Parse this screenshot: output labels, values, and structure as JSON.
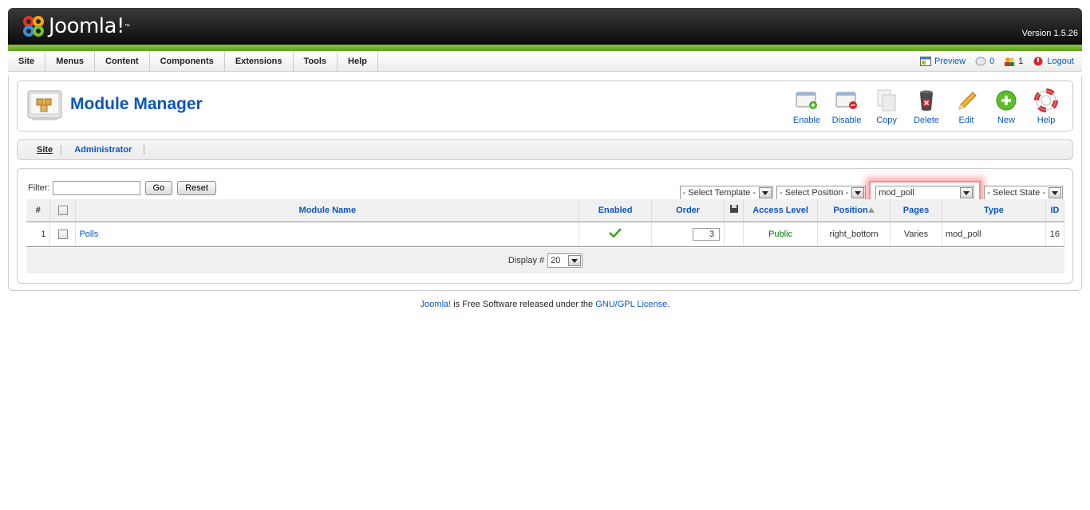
{
  "header": {
    "logo_text": "Joomla!",
    "logo_tm": "™",
    "version": "Version 1.5.26"
  },
  "menu": [
    "Site",
    "Menus",
    "Content",
    "Components",
    "Extensions",
    "Tools",
    "Help"
  ],
  "status": {
    "preview": "Preview",
    "messages_count": "0",
    "users_count": "1",
    "logout": "Logout"
  },
  "page": {
    "title": "Module Manager"
  },
  "toolbar": {
    "enable": "Enable",
    "disable": "Disable",
    "copy": "Copy",
    "delete": "Delete",
    "edit": "Edit",
    "new": "New",
    "help": "Help"
  },
  "submenu": {
    "site": "Site",
    "administrator": "Administrator"
  },
  "filter": {
    "label": "Filter:",
    "value": "",
    "go": "Go",
    "reset": "Reset",
    "select_template": "- Select Template -",
    "select_position": "- Select Position -",
    "select_type": "mod_poll",
    "select_state": "- Select State -"
  },
  "table": {
    "headers": {
      "num": "#",
      "name": "Module Name",
      "enabled": "Enabled",
      "order": "Order",
      "access": "Access Level",
      "position": "Position",
      "pages": "Pages",
      "type": "Type",
      "id": "ID"
    },
    "rows": [
      {
        "num": "1",
        "name": "Polls",
        "order": "3",
        "access": "Public",
        "position": "right_bottom",
        "pages": "Varies",
        "type": "mod_poll",
        "id": "16"
      }
    ],
    "display_label": "Display #",
    "display_value": "20"
  },
  "footer": {
    "joomla_link": "Joomla!",
    "text": " is Free Software released under the ",
    "license_link": "GNU/GPL License",
    "end": "."
  },
  "colors": {
    "link_blue": "#0b55c4",
    "header_green": "#8dc63f",
    "public_green": "#007a00",
    "highlight_red": "#ff3c3c"
  }
}
